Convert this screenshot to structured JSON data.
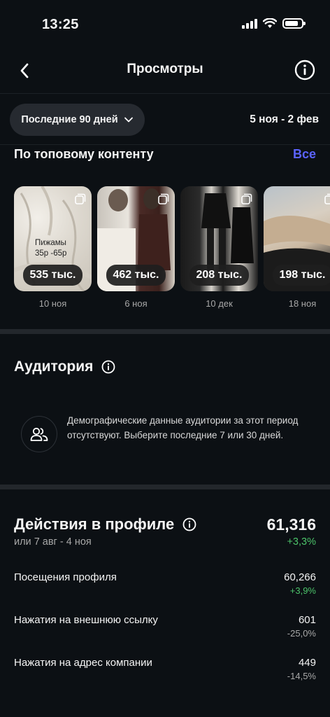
{
  "status_bar": {
    "time": "13:25"
  },
  "nav": {
    "title": "Просмотры"
  },
  "filter": {
    "period_label": "Последние 90 дней",
    "date_range": "5 ноя - 2 фев"
  },
  "top_content": {
    "heading": "По топовому контенту",
    "see_all": "Все",
    "items": [
      {
        "views": "535 тыс.",
        "date": "10 ноя",
        "overlay": "Пижамы\n35р -65р"
      },
      {
        "views": "462 тыс.",
        "date": "6 ноя"
      },
      {
        "views": "208 тыс.",
        "date": "10 дек"
      },
      {
        "views": "198 тыс.",
        "date": "18 ноя"
      }
    ]
  },
  "audience": {
    "title": "Аудитория",
    "empty_message": "Демографические данные аудитории за этот период отсутствуют. Выберите последние 7 или 30 дней."
  },
  "actions": {
    "title": "Действия в профиле",
    "subtitle": "или 7 авг - 4 ноя",
    "total": "61,316",
    "total_delta": "+3,3%",
    "rows": [
      {
        "label": "Посещения профиля",
        "value": "60,266",
        "delta": "+3,9%"
      },
      {
        "label": "Нажатия на внешнюю ссылку",
        "value": "601",
        "delta": "-25,0%"
      },
      {
        "label": "Нажатия на адрес компании",
        "value": "449",
        "delta": "-14,5%"
      }
    ]
  },
  "colors": {
    "background": "#0c1014",
    "accent": "#5b63ff",
    "positive": "#4cc36a"
  }
}
